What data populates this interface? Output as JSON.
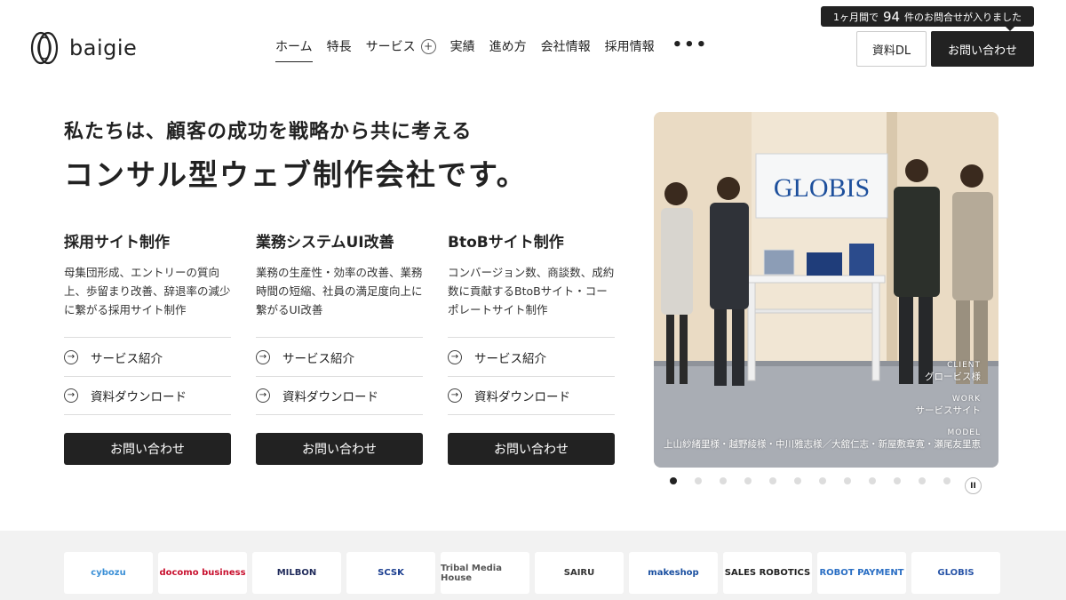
{
  "header": {
    "logo_text": "baigie",
    "nav": [
      "ホーム",
      "特長",
      "サービス",
      "実績",
      "進め方",
      "会社情報",
      "採用情報"
    ],
    "inquiry_badge": {
      "prefix": "1ヶ月間で",
      "count": "94",
      "suffix": "件のお問合せが入りました"
    },
    "download_label": "資料DL",
    "contact_label": "お問い合わせ"
  },
  "hero": {
    "subtitle": "私たちは、顧客の成功を戦略から共に考える",
    "title": "コンサル型ウェブ制作会社です。"
  },
  "services": [
    {
      "title": "採用サイト制作",
      "description": "母集団形成、エントリーの質向上、歩留まり改善、辞退率の減少に繋がる採用サイト制作",
      "link1": "サービス紹介",
      "link2": "資料ダウンロード",
      "button": "お問い合わせ"
    },
    {
      "title": "業務システムUI改善",
      "description": "業務の生産性・効率の改善、業務時間の短縮、社員の満足度向上に繋がるUI改善",
      "link1": "サービス紹介",
      "link2": "資料ダウンロード",
      "button": "お問い合わせ"
    },
    {
      "title": "BtoBサイト制作",
      "description": "コンバージョン数、商談数、成約数に貢献するBtoBサイト・コーポレートサイト制作",
      "link1": "サービス紹介",
      "link2": "資料ダウンロード",
      "button": "お問い合わせ"
    }
  ],
  "slide": {
    "sign_text": "GLOBIS",
    "client_label": "CLIENT",
    "client_value": "グロービス様",
    "work_label": "WORK",
    "work_value": "サービスサイト",
    "model_label": "MODEL",
    "model_value": "上山紗緒里様・越野綾様・中川雅志様／大舘仁志・新屋敷章寛・瀬尾友里恵"
  },
  "carousel": {
    "total": 12,
    "active": 1
  },
  "clients": [
    {
      "name": "cybozu",
      "color": "#3a8fd6"
    },
    {
      "name": "docomo business",
      "color": "#c8102e"
    },
    {
      "name": "MILBON",
      "color": "#1f2a5a"
    },
    {
      "name": "SCSK",
      "color": "#1a3d8f"
    },
    {
      "name": "Tribal Media House",
      "color": "#555555"
    },
    {
      "name": "SAIRU",
      "color": "#333333"
    },
    {
      "name": "makeshop",
      "color": "#1a4fa0"
    },
    {
      "name": "SALES ROBOTICS",
      "color": "#222222"
    },
    {
      "name": "ROBOT PAYMENT",
      "color": "#2b6fc4"
    },
    {
      "name": "GLOBIS",
      "color": "#2a56a8"
    }
  ]
}
